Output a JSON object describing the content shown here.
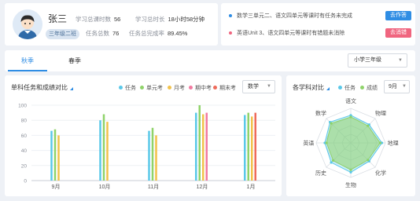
{
  "profile": {
    "name": "张三",
    "class": "三年级二班",
    "stats": [
      {
        "label": "学习总课时数",
        "value": "56"
      },
      {
        "label": "学习总时长",
        "value": "18小时58分钟"
      },
      {
        "label": "任务总数",
        "value": "76"
      },
      {
        "label": "任务总完成率",
        "value": "89.45%"
      }
    ]
  },
  "notices": [
    {
      "text": "数学三单元二、语文四单元等课时有任务未完成",
      "button": "去作答",
      "color": "#2f8de4"
    },
    {
      "text": "英语Unit 3、语文四单元等课时有错题未消除",
      "button": "去消错",
      "color": "#f0657f"
    }
  ],
  "tabs": [
    "秋季",
    "春季"
  ],
  "active_tab": 0,
  "grade_select": "小学三年级",
  "bar_card": {
    "title": "单科任务和成绩对比",
    "subject_select": "数学"
  },
  "radar_card": {
    "title": "各学科对比",
    "month_select": "9月"
  },
  "icons": {
    "dropdown": "chevron-down-icon",
    "corner": "corner-triangle-icon",
    "avatar": "student-avatar-icon"
  },
  "chart_data": [
    {
      "type": "bar",
      "title": "单科任务和成绩对比",
      "categories": [
        "9月",
        "10月",
        "11月",
        "12月",
        "1月"
      ],
      "ylim": [
        0,
        100
      ],
      "yticks": [
        0,
        20,
        40,
        60,
        80,
        100
      ],
      "grid": true,
      "legend_position": "top-right",
      "series": [
        {
          "name": "任务",
          "color": "#5ac8e8",
          "values": [
            66,
            80,
            66,
            90,
            87
          ]
        },
        {
          "name": "单元考",
          "color": "#8fd36a",
          "values": [
            68,
            88,
            70,
            100,
            90
          ]
        },
        {
          "name": "月考",
          "color": "#f2c24b",
          "values": [
            60,
            78,
            60,
            88,
            85
          ]
        },
        {
          "name": "期中考",
          "color": "#f27aa0",
          "values": [
            null,
            null,
            null,
            90,
            null
          ]
        },
        {
          "name": "期末考",
          "color": "#ee6b5b",
          "values": [
            null,
            null,
            null,
            null,
            90
          ]
        }
      ]
    },
    {
      "type": "radar",
      "title": "各学科对比",
      "axes": [
        "语文",
        "物理",
        "地理",
        "化学",
        "生物",
        "历史",
        "英语",
        "数学"
      ],
      "range": [
        0,
        100
      ],
      "legend_position": "top",
      "series": [
        {
          "name": "任务",
          "color": "#5ac8e8",
          "values": [
            80,
            75,
            90,
            75,
            85,
            80,
            75,
            85
          ]
        },
        {
          "name": "成绩",
          "color": "#8fd36a",
          "values": [
            75,
            70,
            85,
            70,
            78,
            72,
            70,
            80
          ]
        }
      ]
    }
  ]
}
